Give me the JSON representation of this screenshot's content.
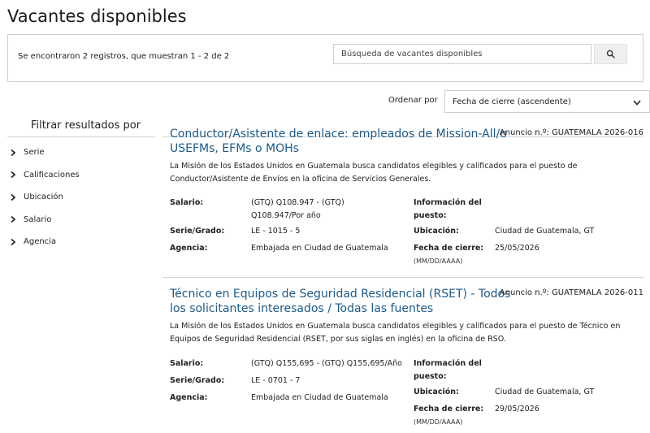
{
  "page": {
    "title": "Vacantes disponibles"
  },
  "search": {
    "results_summary": "Se encontraron 2 registros, que muestran 1 - 2 de 2",
    "placeholder": "Búsqueda de vacantes disponibles",
    "button_icon": "search-icon"
  },
  "sort": {
    "label": "Ordenar por",
    "selected": "Fecha de cierre (ascendente)"
  },
  "filters": {
    "title": "Filtrar resultados por",
    "items": [
      {
        "label": "Serie"
      },
      {
        "label": "Calificaciones"
      },
      {
        "label": "Ubicación"
      },
      {
        "label": "Salario"
      },
      {
        "label": "Agencia"
      }
    ]
  },
  "vacancies": [
    {
      "title": "Conductor/Asistente de enlace: empleados de Mission-All/o USEFMs, EFMs o MOHs",
      "number": "Anuncio n.º: GUATEMALA 2026-016",
      "description": "La Misión de los Estados Unidos en Guatemala busca candidatos elegibles y calificados para el puesto de Conductor/Asistente de Envíos en la oficina de Servicios Generales.",
      "salary_label": "Salario:",
      "salary_value": "(GTQ) Q108.947 - (GTQ) Q108.947/Por año",
      "grade_label": "Serie/Grado:",
      "grade_value": "LE - 1015 - 5",
      "agency_label": "Agencia:",
      "agency_value": "Embajada en Ciudad de Guatemala",
      "info_label": "Información del puesto:",
      "location_label": "Ubicación:",
      "location_value": "Ciudad de Guatemala, GT",
      "close_label": "Fecha de cierre:",
      "close_format": "(MM/DD/AAAA)",
      "close_value": "25/05/2026"
    },
    {
      "title": "Técnico en Equipos de Seguridad Residencial (RSET) - Todos los solicitantes interesados / Todas las fuentes",
      "number": "Anuncio n.º: GUATEMALA 2026-011",
      "description": "La Misión de los Estados Unidos en Guatemala busca candidatos elegibles y calificados para el puesto de Técnico en Equipos de Seguridad Residencial (RSET, por sus siglas en inglés) en la oficina de RSO.",
      "salary_label": "Salario:",
      "salary_value": "(GTQ) Q155,695 - (GTQ) Q155,695/Año",
      "grade_label": "Serie/Grado:",
      "grade_value": "LE - 0701 - 7",
      "agency_label": "Agencia:",
      "agency_value": "Embajada en Ciudad de Guatemala",
      "info_label": "Información del puesto:",
      "location_label": "Ubicación:",
      "location_value": "Ciudad de Guatemala, GT",
      "close_label": "Fecha de cierre:",
      "close_format": "(MM/DD/AAAA)",
      "close_value": "29/05/2026"
    }
  ]
}
